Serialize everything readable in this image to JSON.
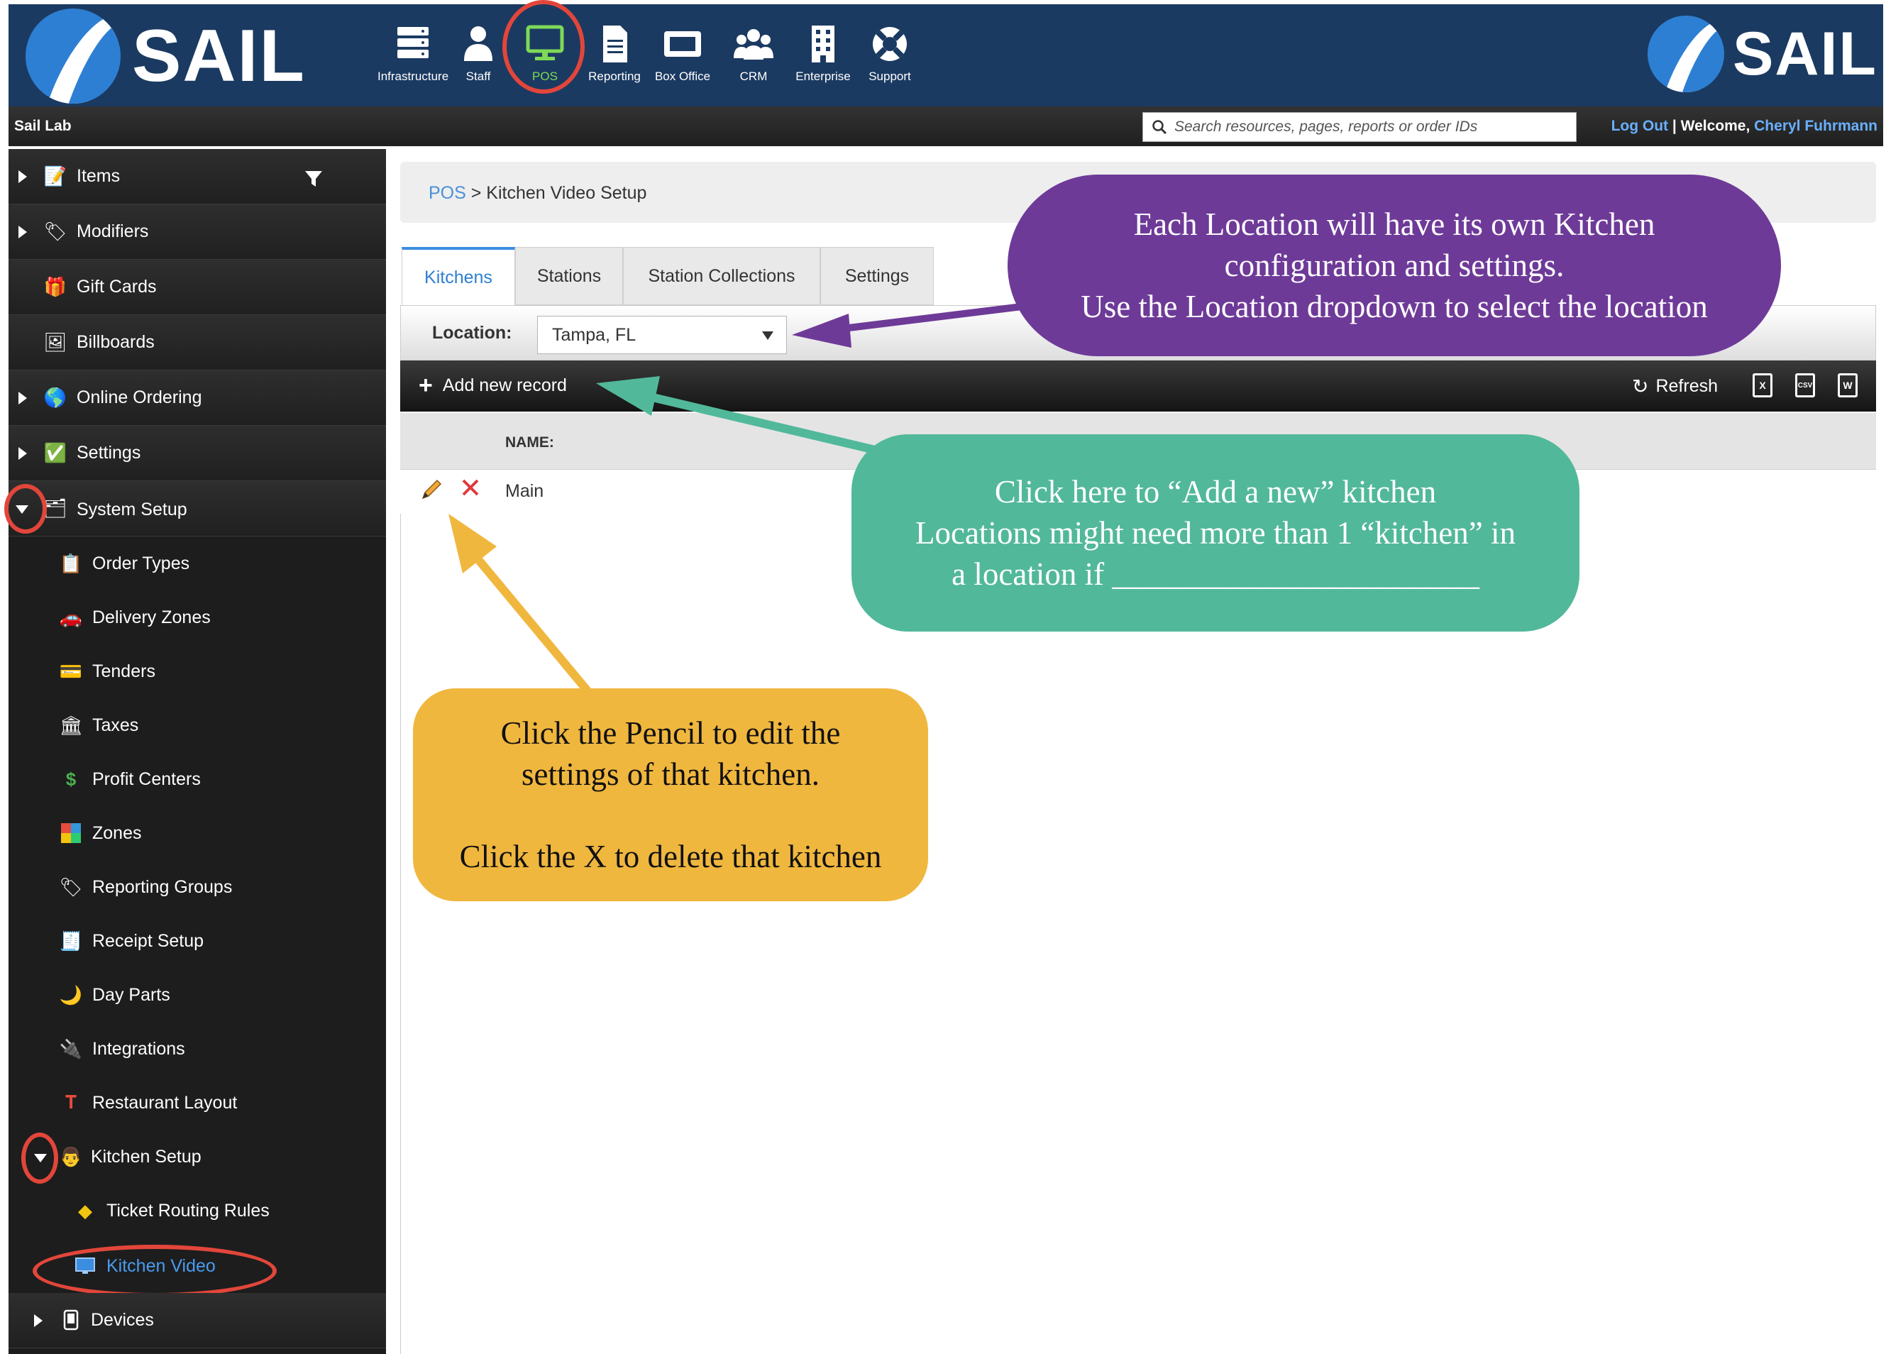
{
  "header": {
    "brand": "SAIL",
    "modules": [
      {
        "label": "Infrastructure",
        "icon": "server-icon"
      },
      {
        "label": "Staff",
        "icon": "person-icon"
      },
      {
        "label": "POS",
        "icon": "monitor-icon"
      },
      {
        "label": "Reporting",
        "icon": "document-icon"
      },
      {
        "label": "Box Office",
        "icon": "ticket-icon"
      },
      {
        "label": "CRM",
        "icon": "people-icon"
      },
      {
        "label": "Enterprise",
        "icon": "building-icon"
      },
      {
        "label": "Support",
        "icon": "lifebuoy-icon"
      }
    ]
  },
  "subbar": {
    "tenant": "Sail Lab",
    "search_placeholder": "Search resources, pages, reports or order IDs",
    "logout": "Log Out",
    "separator": "|",
    "welcome": "Welcome,",
    "user": "Cheryl Fuhrmann"
  },
  "sidebar": {
    "items": [
      {
        "label": "Items",
        "icon": "items-icon"
      },
      {
        "label": "Modifiers",
        "icon": "tag-icon"
      },
      {
        "label": "Gift Cards",
        "icon": "gift-card-icon"
      },
      {
        "label": "Billboards",
        "icon": "billboard-icon"
      },
      {
        "label": "Online Ordering",
        "icon": "globe-icon"
      },
      {
        "label": "Settings",
        "icon": "settings-icon"
      },
      {
        "label": "System Setup",
        "icon": "system-setup-icon"
      },
      {
        "label": "Order Types",
        "icon": "order-types-icon"
      },
      {
        "label": "Delivery Zones",
        "icon": "car-icon"
      },
      {
        "label": "Tenders",
        "icon": "credit-card-icon"
      },
      {
        "label": "Taxes",
        "icon": "bank-icon"
      },
      {
        "label": "Profit Centers",
        "icon": "dollar-icon"
      },
      {
        "label": "Zones",
        "icon": "zones-icon"
      },
      {
        "label": "Reporting Groups",
        "icon": "tag-icon"
      },
      {
        "label": "Receipt Setup",
        "icon": "receipt-icon"
      },
      {
        "label": "Day Parts",
        "icon": "day-parts-icon"
      },
      {
        "label": "Integrations",
        "icon": "plug-icon"
      },
      {
        "label": "Restaurant Layout",
        "icon": "table-icon"
      },
      {
        "label": "Kitchen Setup",
        "icon": "chef-icon"
      },
      {
        "label": "Ticket Routing Rules",
        "icon": "routing-sign-icon"
      },
      {
        "label": "Kitchen Video",
        "icon": "screen-icon"
      },
      {
        "label": "Devices",
        "icon": "device-icon"
      }
    ]
  },
  "breadcrumb": {
    "root": "POS",
    "sep": " > ",
    "current": "Kitchen Video Setup"
  },
  "tabs": [
    {
      "label": "Kitchens",
      "active": true
    },
    {
      "label": "Stations",
      "active": false
    },
    {
      "label": "Station Collections",
      "active": false
    },
    {
      "label": "Settings",
      "active": false
    }
  ],
  "location": {
    "label": "Location:",
    "value": "Tampa, FL"
  },
  "grid": {
    "add_label": "Add new record",
    "refresh_label": "Refresh",
    "exports": [
      "X",
      "CSV",
      "W"
    ],
    "columns": [
      "NAME:"
    ],
    "rows": [
      {
        "name": "Main"
      }
    ]
  },
  "annotations": {
    "purple": [
      "Each Location will have its own Kitchen",
      "configuration and settings.",
      "Use the Location dropdown to select the location"
    ],
    "teal": [
      "Click here to “Add a new” kitchen",
      "Locations might need more than 1 “kitchen” in",
      "a location if _______________________"
    ],
    "yellow": [
      "Click the Pencil to edit the",
      "settings of that kitchen.",
      "",
      "Click the X to delete that kitchen"
    ]
  },
  "colors": {
    "header_bg": "#1b3a61",
    "accent_blue": "#3b8de0",
    "pos_active": "#7ed957",
    "highlight_ring": "#e2463a",
    "callout_purple": "#6e3a98",
    "callout_teal": "#52b89a",
    "callout_yellow": "#f0b73e"
  }
}
